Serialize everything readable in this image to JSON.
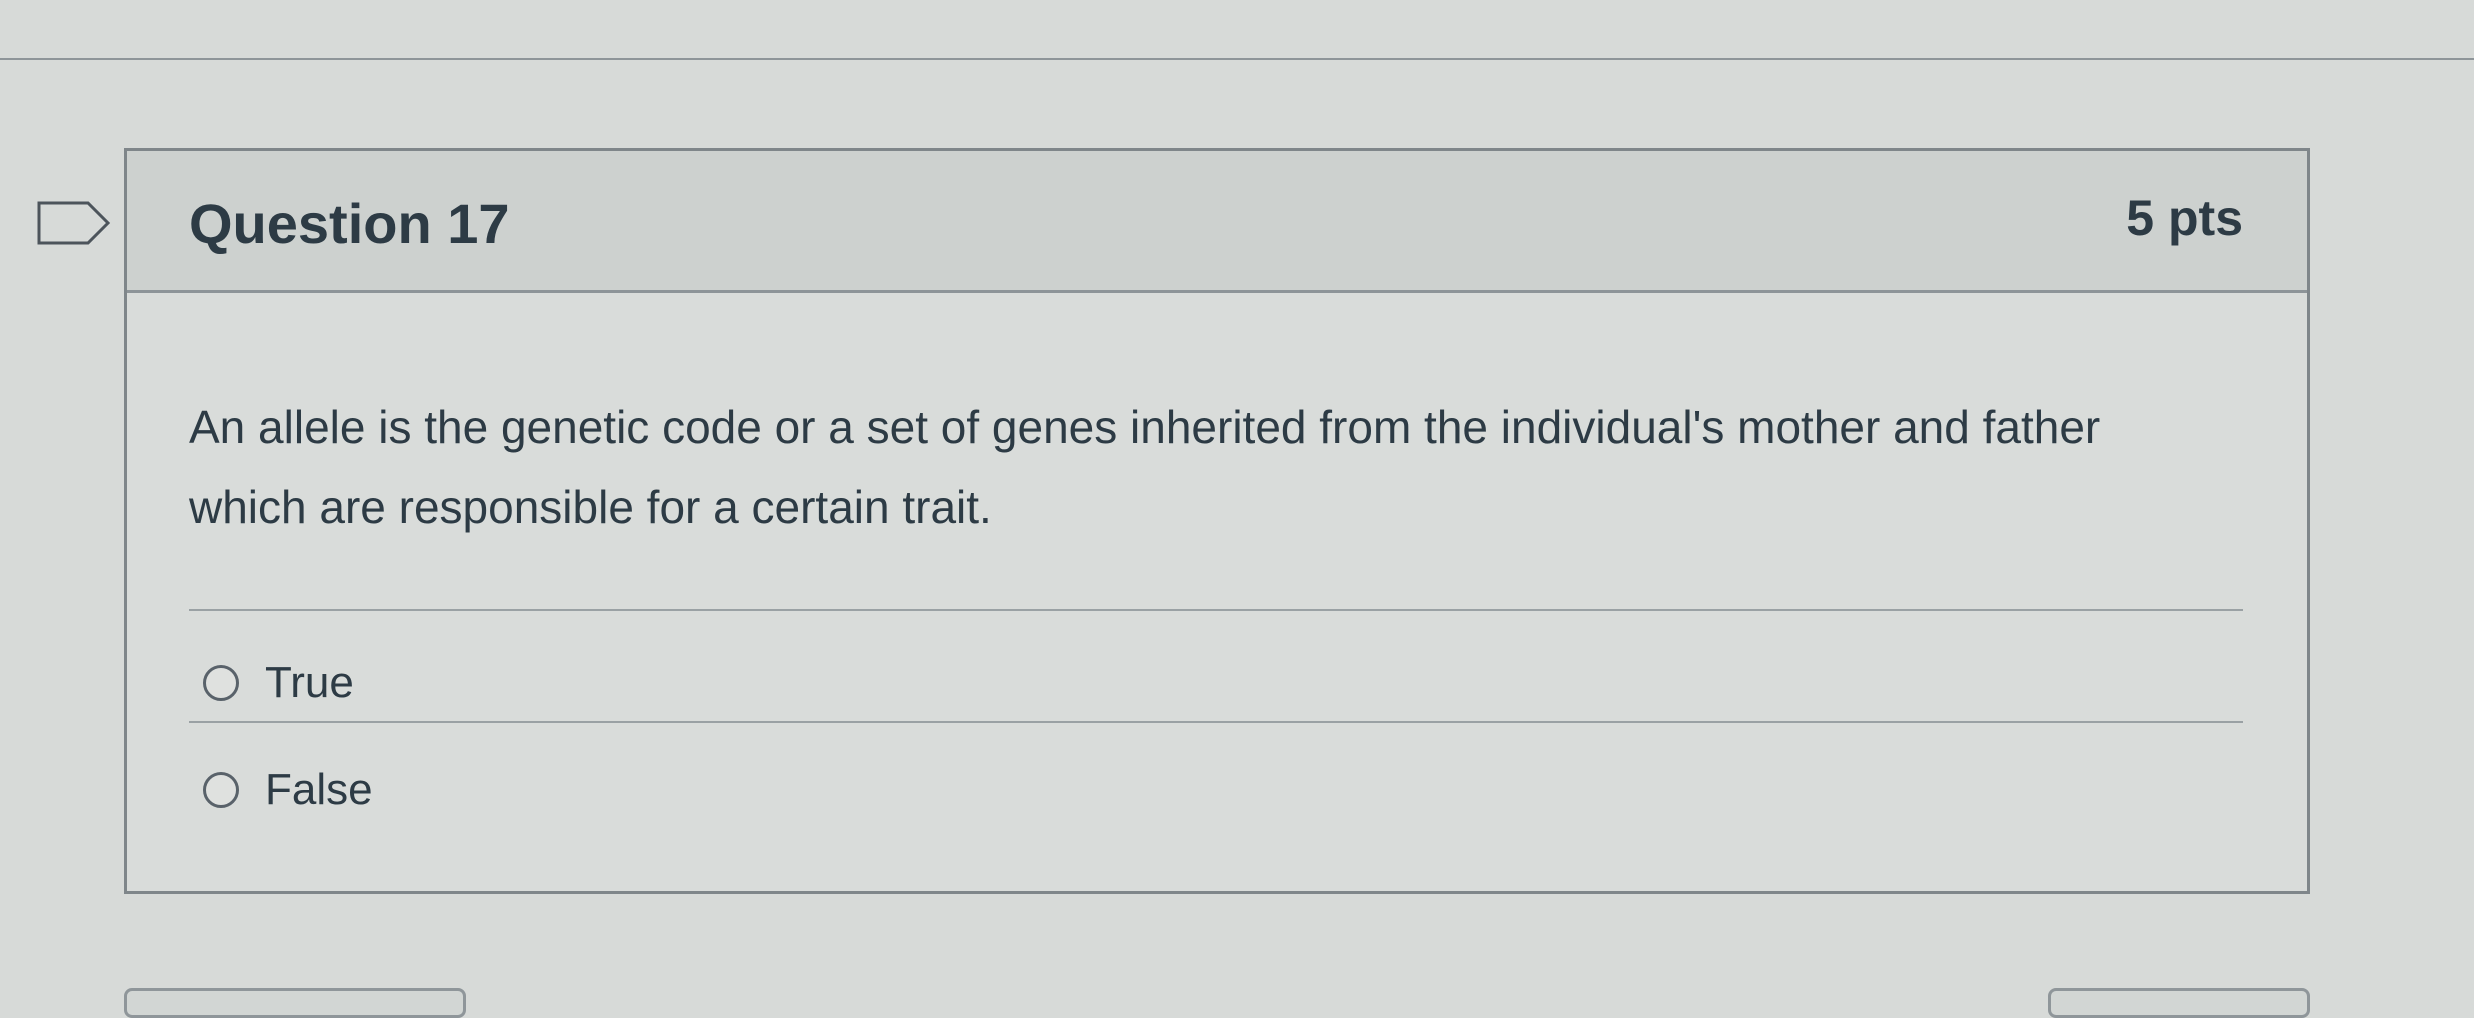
{
  "question": {
    "title": "Question 17",
    "points": "5 pts",
    "text": "An allele is the genetic code or a set of genes inherited from the individual's mother and father which are responsible for a certain trait.",
    "answers": [
      {
        "label": "True",
        "selected": false
      },
      {
        "label": "False",
        "selected": false
      }
    ]
  },
  "icons": {
    "bookmark": "bookmark-flag-icon",
    "radio": "radio-button-icon"
  },
  "colors": {
    "background": "#d7dad8",
    "header": "#cdd1cf",
    "text": "#2d3b45",
    "border": "#7f868a"
  }
}
